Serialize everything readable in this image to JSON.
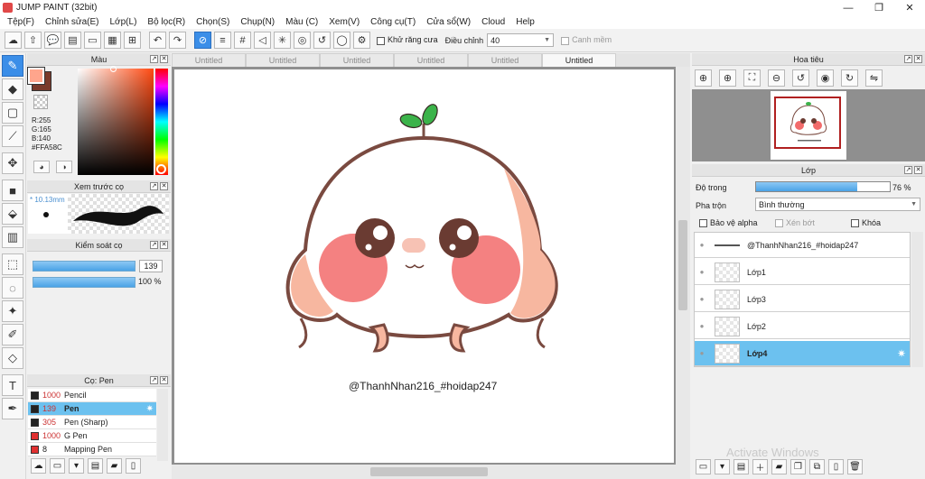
{
  "window": {
    "title": "JUMP PAINT (32bit)",
    "controls": [
      "—",
      "❐",
      "✕"
    ]
  },
  "menu": [
    "Tệp(F)",
    "Chỉnh sửa(E)",
    "Lớp(L)",
    "Bộ lọc(R)",
    "Chọn(S)",
    "Chụp(N)",
    "Màu (C)",
    "Xem(V)",
    "Công cụ(T)",
    "Cửa sổ(W)",
    "Cloud",
    "Help"
  ],
  "toolbar": {
    "antialias_label": "Khử răng cưa",
    "adjust_label": "Điều chỉnh",
    "adjust_value": "40",
    "snap_label": "Canh mềm"
  },
  "color_panel": {
    "title": "Màu",
    "r": "R:255",
    "g": "G:165",
    "b": "B:140",
    "hex": "#FFA58C",
    "primary_color": "#ffa58c",
    "secondary_color": "#7a3a2a"
  },
  "brush_preview": {
    "title": "Xem trước cọ",
    "size": "10.13mm"
  },
  "brush_control": {
    "title": "Kiểm soát cọ",
    "size_value": "139",
    "opacity_value": "100 %"
  },
  "brush_list": {
    "title": "Cọ: Pen",
    "items": [
      {
        "size": "1000",
        "name": "Pencil",
        "color": "#222222"
      },
      {
        "size": "139",
        "name": "Pen",
        "color": "#222222"
      },
      {
        "size": "305",
        "name": "Pen (Sharp)",
        "color": "#222222"
      },
      {
        "size": "1000",
        "name": "G Pen",
        "color": "#e03030"
      },
      {
        "size": "8",
        "name": "Mapping Pen",
        "color": "#e03030"
      }
    ],
    "selected_index": 1
  },
  "tabs": [
    "Untitled",
    "Untitled",
    "Untitled",
    "Untitled",
    "Untitled",
    "Untitled"
  ],
  "active_tab_index": 5,
  "canvas": {
    "watermark_text": "@ThanhNhan216_#hoidap247"
  },
  "navigator": {
    "title": "Hoa tiêu"
  },
  "layer_panel": {
    "title": "Lớp",
    "opacity_label": "Độ trong",
    "opacity_value": "76 %",
    "opacity_fraction": 0.76,
    "blend_label": "Pha trộn",
    "blend_value": "Bình thường",
    "protect_alpha_label": "Bảo vệ alpha",
    "clip_label": "Xén bớt",
    "lock_label": "Khóa",
    "layers": [
      {
        "name": "@ThanhNhan216_#hoidap247"
      },
      {
        "name": "Lớp1"
      },
      {
        "name": "Lớp3"
      },
      {
        "name": "Lớp2"
      },
      {
        "name": "Lớp4"
      }
    ],
    "selected_index": 4
  },
  "os_watermark": "Activate Windows"
}
